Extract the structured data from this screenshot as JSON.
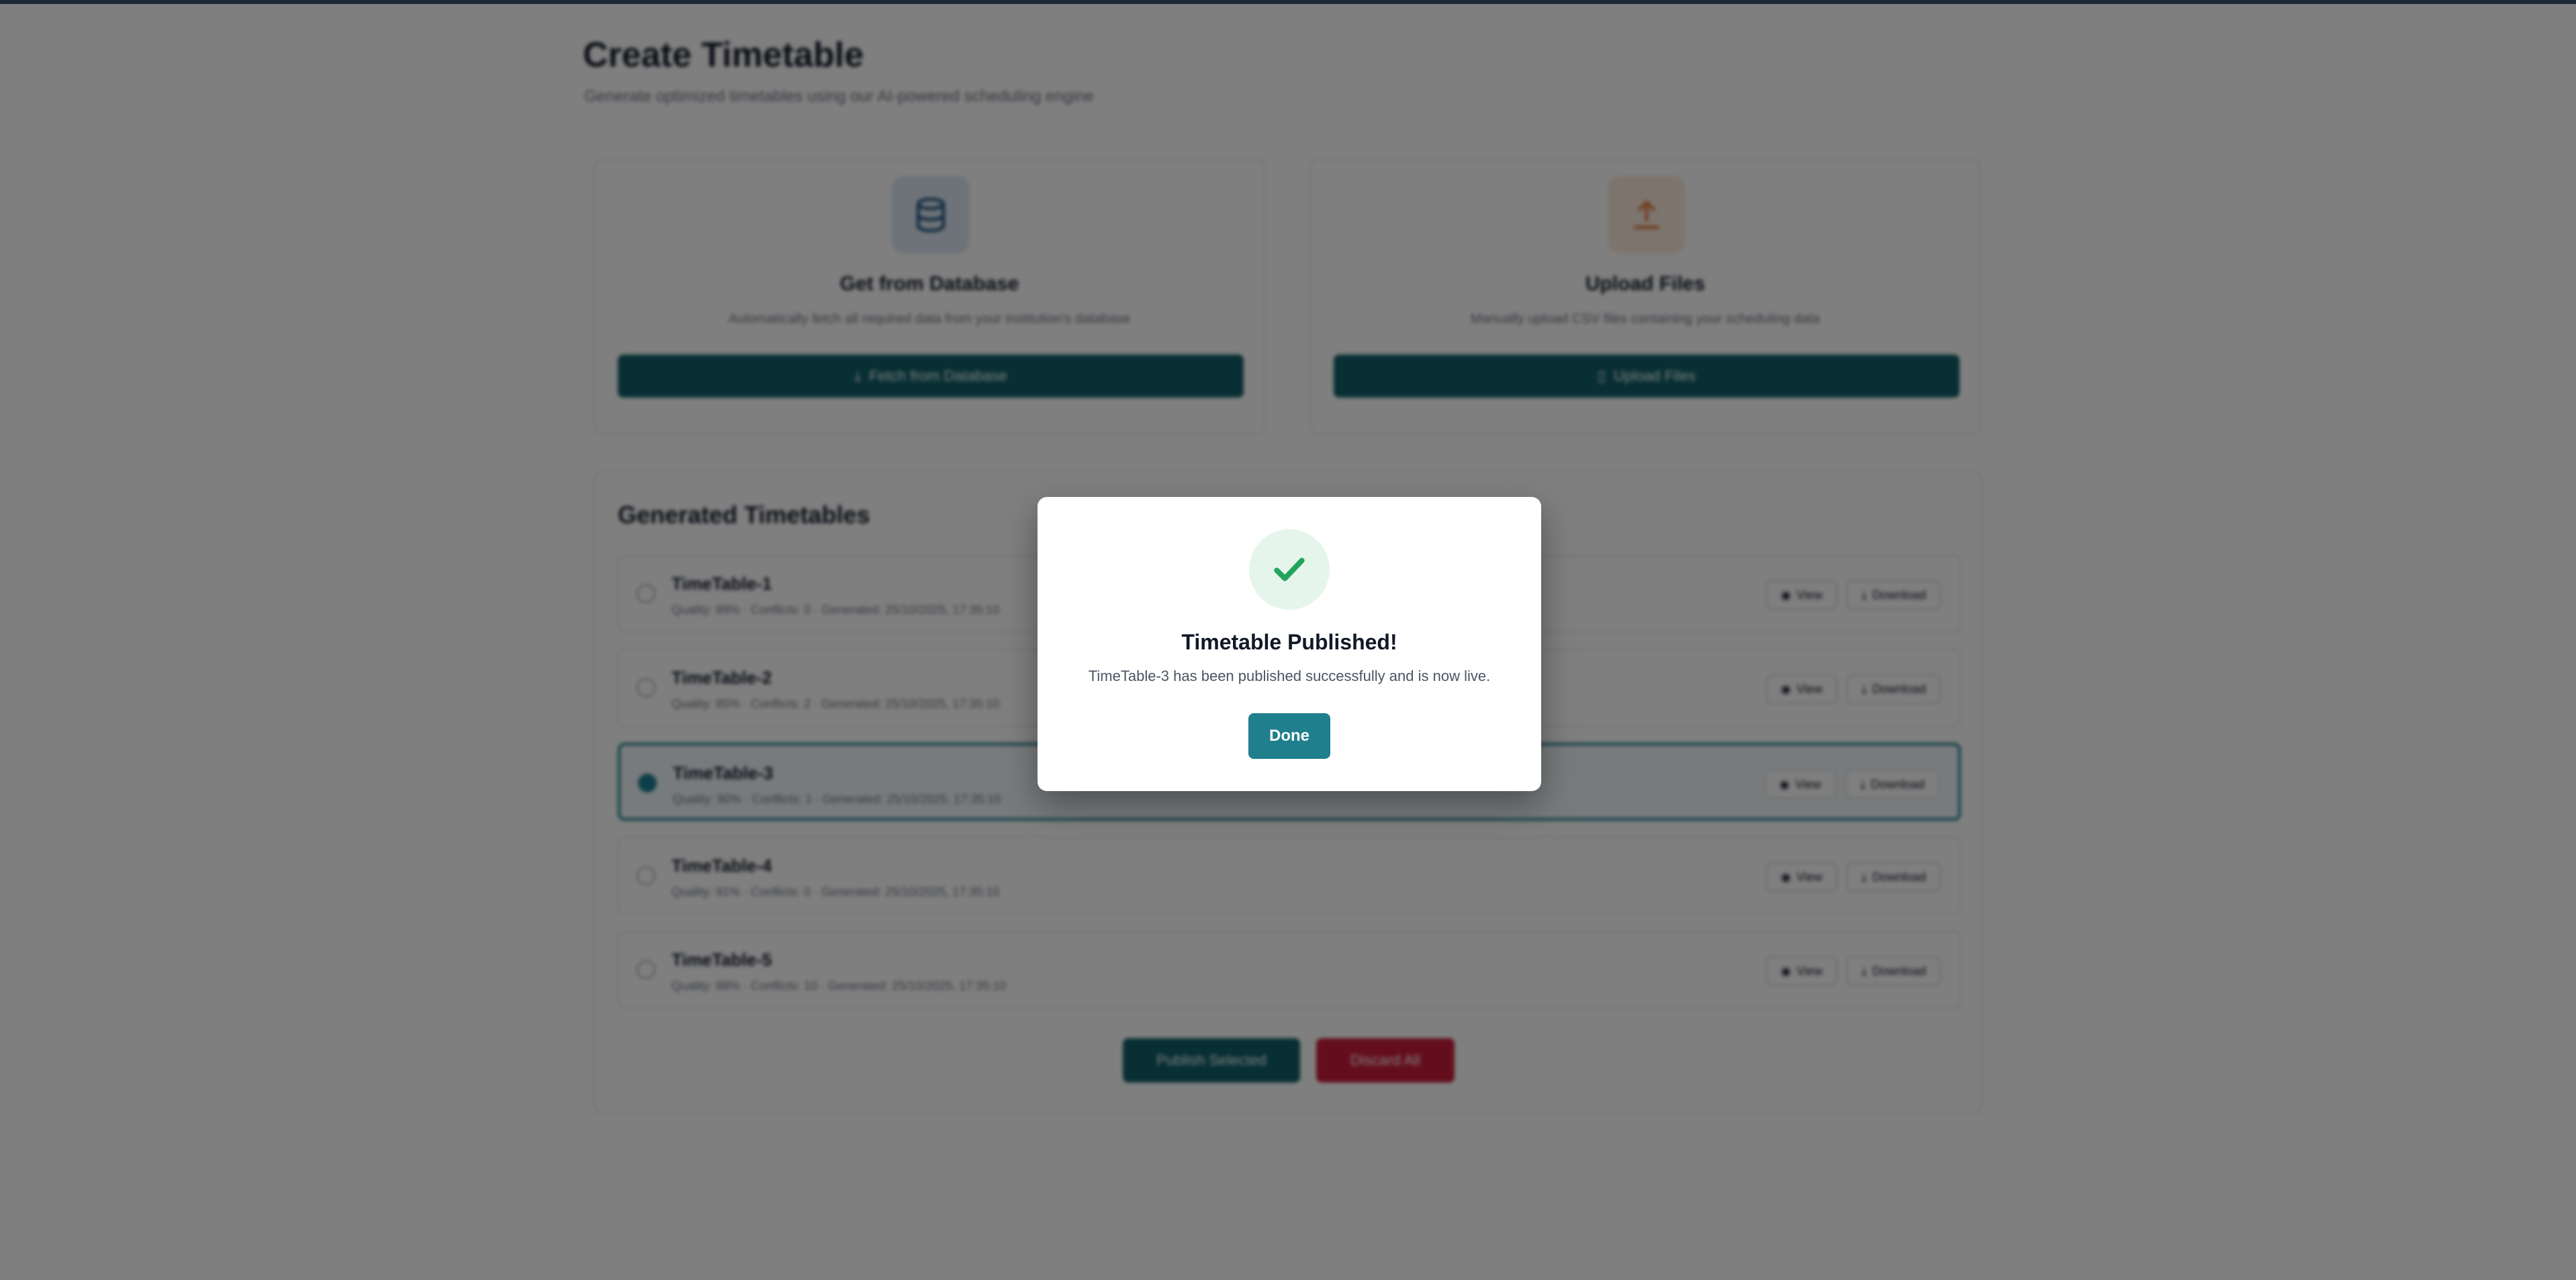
{
  "page": {
    "title": "Create Timetable",
    "subtitle": "Generate optimized timetables using our AI-powered scheduling engine"
  },
  "sources": [
    {
      "title": "Get from Database",
      "description": "Automatically fetch all required data from your institution's database",
      "button_label": "Fetch from Database",
      "icon": "database-icon"
    },
    {
      "title": "Upload Files",
      "description": "Manually upload CSV files containing your scheduling data",
      "button_label": "Upload Files",
      "icon": "upload-icon"
    }
  ],
  "generated": {
    "heading": "Generated Timetables",
    "view_label": "View",
    "download_label": "Download",
    "items": [
      {
        "name": "TimeTable-1",
        "meta": "Quality: 89%  ·  Conflicts: 0  ·  Generated: 25/10/2025, 17:35:10",
        "selected": false
      },
      {
        "name": "TimeTable-2",
        "meta": "Quality: 85%  ·  Conflicts: 2  ·  Generated: 25/10/2025, 17:35:10",
        "selected": false
      },
      {
        "name": "TimeTable-3",
        "meta": "Quality: 90%  ·  Conflicts: 1  ·  Generated: 25/10/2025, 17:35:10",
        "selected": true
      },
      {
        "name": "TimeTable-4",
        "meta": "Quality: 91%  ·  Conflicts: 0  ·  Generated: 25/10/2025, 17:35:10",
        "selected": false
      },
      {
        "name": "TimeTable-5",
        "meta": "Quality: 88%  ·  Conflicts: 10  ·  Generated: 25/10/2025, 17:35:10",
        "selected": false
      }
    ],
    "publish_label": "Publish Selected",
    "delete_label": "Discard All"
  },
  "modal": {
    "title": "Timetable Published!",
    "message": "TimeTable-3 has been published successfully and is now live.",
    "done_label": "Done",
    "icon": "checkmark-icon"
  },
  "colors": {
    "accent": "#1f7f8d",
    "success": "#22a45d",
    "danger": "#c81d3a"
  }
}
